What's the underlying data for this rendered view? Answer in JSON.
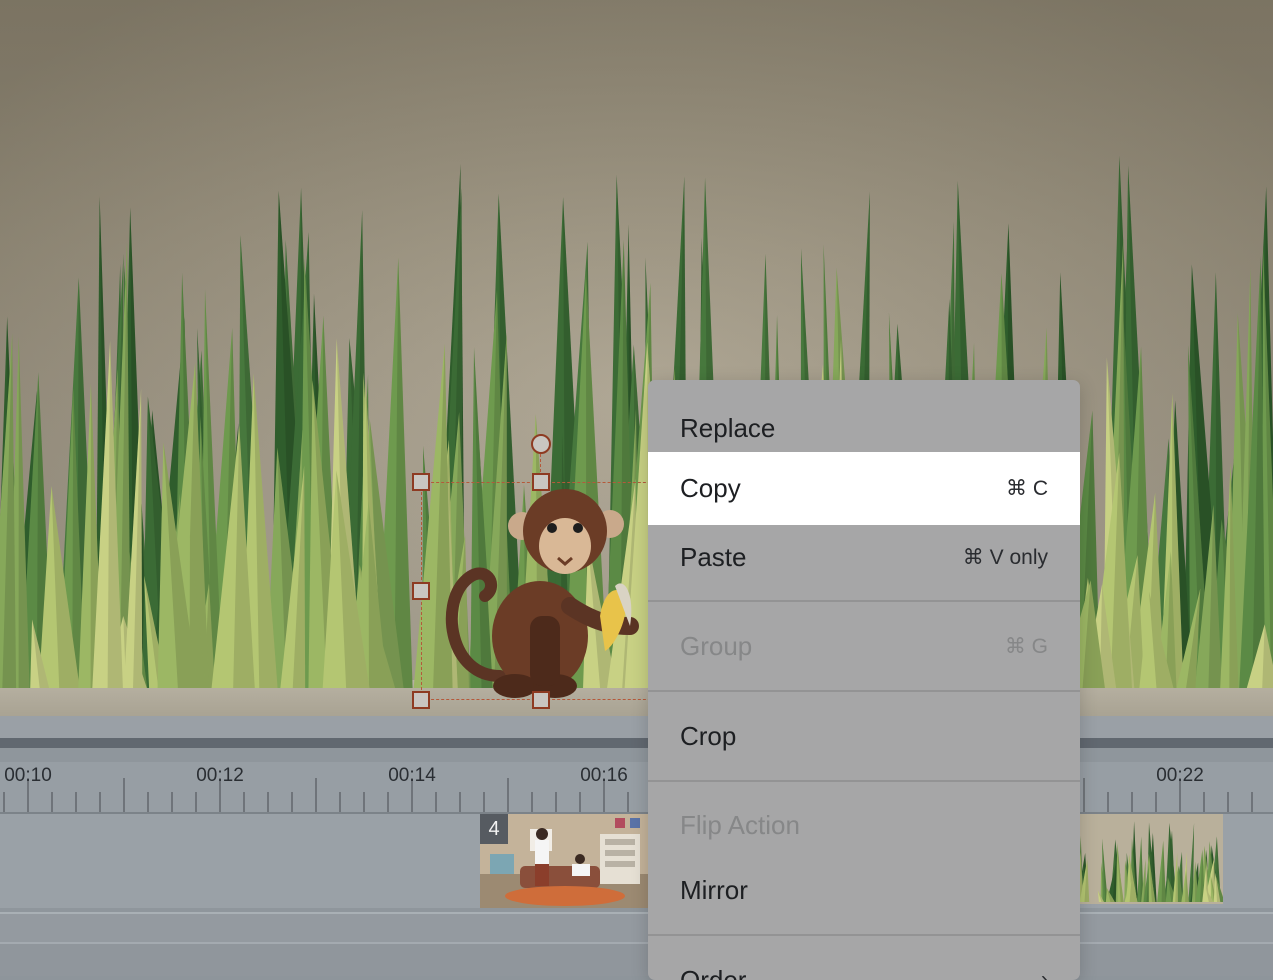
{
  "timeline": {
    "ticks": [
      "00:10",
      "00:12",
      "00:14",
      "00:16",
      "00:22"
    ],
    "clip_badge": "4"
  },
  "context_menu": {
    "replace": "Replace",
    "copy": {
      "label": "Copy",
      "shortcut": "⌘ C"
    },
    "paste": {
      "label": "Paste",
      "shortcut": "⌘ V only"
    },
    "group": {
      "label": "Group",
      "shortcut": "⌘ G"
    },
    "crop": "Crop",
    "flip_section": "Flip Action",
    "mirror": "Mirror",
    "partial_item": "Order",
    "partial_chevron": "›"
  },
  "colors": {
    "menu_bg": "#a6a6a7",
    "menu_highlight": "#ffffff",
    "selection_accent": "#8e3b22"
  }
}
